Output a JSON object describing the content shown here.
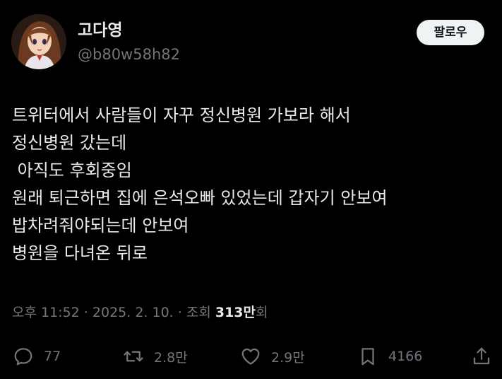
{
  "user": {
    "display_name": "고다영",
    "handle": "@b80w58h82",
    "avatar_icon": "anime-girl-avatar-icon"
  },
  "follow_label": "팔로우",
  "tweet": {
    "lines": [
      "트위터에서 사람들이 자꾸 정신병원 가보라 해서",
      "정신병원 갔는데",
      " 아직도 후회중임",
      "원래 퇴근하면 집에 은석오빠 있었는데 갑자기 안보여",
      "밥차려줘야되는데 안보여",
      "병원을 다녀온 뒤로"
    ]
  },
  "meta": {
    "time": "오후 11:52",
    "separator": " · ",
    "date": "2025. 2. 10.",
    "views_label": "조회 ",
    "views_count": "313만",
    "views_suffix": "회"
  },
  "actions": {
    "reply_count": "77",
    "retweet_count": "2.8만",
    "like_count": "2.9만",
    "bookmark_count": "4166"
  },
  "colors": {
    "background": "#000000",
    "text": "#e7e9ea",
    "secondary": "#71767b",
    "button_bg": "#eff3f4"
  }
}
